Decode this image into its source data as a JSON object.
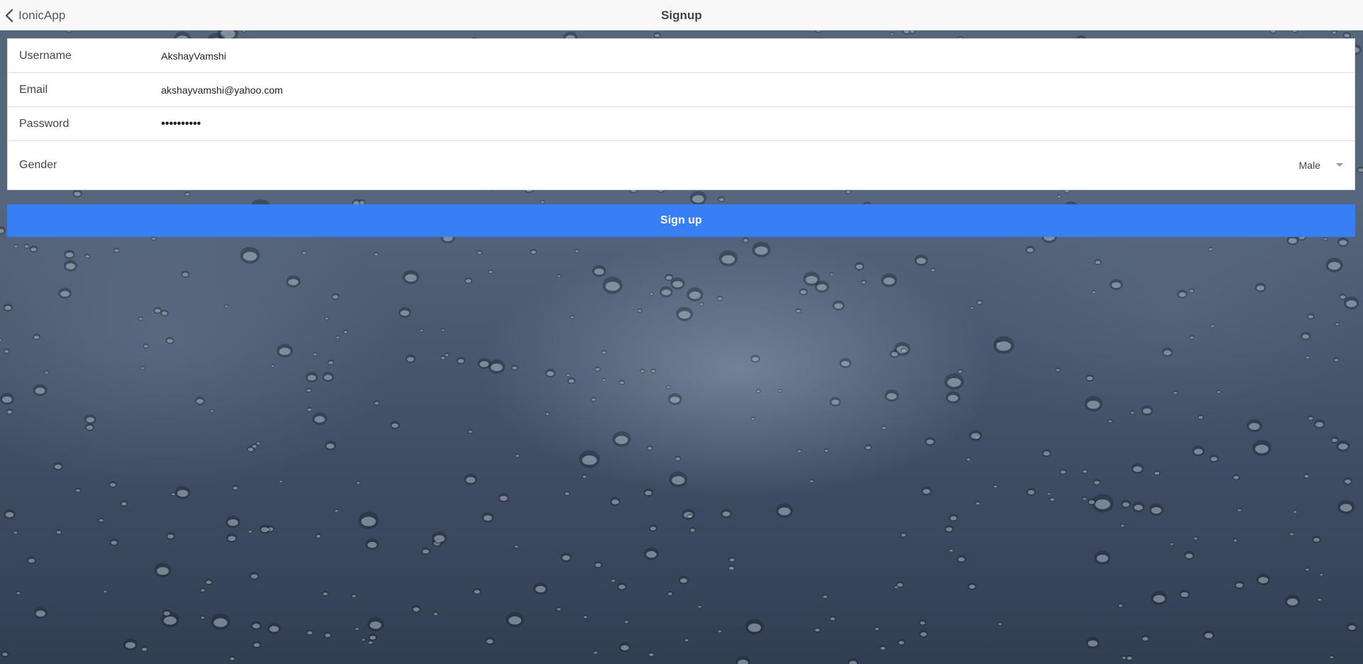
{
  "header": {
    "back_label": "IonicApp",
    "title": "Signup"
  },
  "form": {
    "username": {
      "label": "Username",
      "value": "AkshayVamshi"
    },
    "email": {
      "label": "Email",
      "value": "akshayvamshi@yahoo.com"
    },
    "password": {
      "label": "Password",
      "value": "••••••••••"
    },
    "gender": {
      "label": "Gender",
      "value": "Male"
    }
  },
  "signup_button_label": "Sign up",
  "colors": {
    "primary": "#387ef5",
    "header_bg": "#f8f8f8"
  },
  "icons": {
    "back": "chevron-left-icon",
    "select": "caret-down-icon"
  }
}
